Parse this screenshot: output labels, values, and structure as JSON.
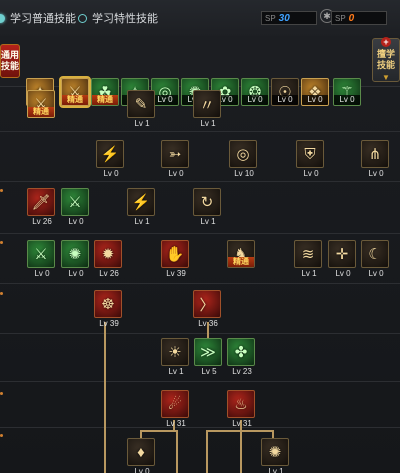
{
  "tabs": {
    "normal_label": "学习普通技能",
    "special_label": "学习特性技能"
  },
  "sp": {
    "blue_label": "SP",
    "blue_value": "30",
    "orange_label": "SP",
    "orange_value": "0"
  },
  "left_button": {
    "line1": "通用",
    "line2": "技能"
  },
  "right_button": {
    "line1": "擅学",
    "line2": "技能"
  },
  "quick_skills": [
    {
      "label": "精通",
      "style": "gold"
    },
    {
      "label": "精通",
      "style": "gold"
    },
    {
      "label": "精通",
      "style": "green"
    },
    {
      "label": "Lv 0",
      "style": "green"
    },
    {
      "label": "Lv 0",
      "style": "green"
    },
    {
      "label": "Lv 0",
      "style": "green"
    },
    {
      "label": "Lv 0",
      "style": "green"
    },
    {
      "label": "Lv 0",
      "style": "green"
    },
    {
      "label": "Lv 0",
      "style": "dark"
    },
    {
      "label": "Lv 0",
      "style": "gold"
    },
    {
      "label": "Lv 0",
      "style": "green"
    }
  ],
  "tree_skills": [
    {
      "label": "精通",
      "icon": "sword-slash-icon"
    },
    {
      "label": "Lv 1",
      "icon": "claw-icon"
    },
    {
      "label": "Lv 1",
      "icon": "wind-blade-icon"
    },
    {
      "label": "Lv 0",
      "icon": "dagger-icon"
    },
    {
      "label": "Lv 0",
      "icon": "arrow-icon"
    },
    {
      "label": "Lv 10",
      "icon": "spiral-icon"
    },
    {
      "label": "Lv 0",
      "icon": "shield-icon"
    },
    {
      "label": "Lv 0",
      "icon": "trident-icon"
    },
    {
      "label": "Lv 26",
      "icon": "blade-icon"
    },
    {
      "label": "Lv 0",
      "icon": "green-blade-icon"
    },
    {
      "label": "Lv 1",
      "icon": "strike-icon"
    },
    {
      "label": "Lv 1",
      "icon": "whirl-icon"
    },
    {
      "label": "Lv 0",
      "icon": "green-slash-icon"
    },
    {
      "label": "Lv 0",
      "icon": "green-burst-icon"
    },
    {
      "label": "Lv 26",
      "icon": "flame-orb-icon"
    },
    {
      "label": "Lv 39",
      "icon": "fire-hand-icon"
    },
    {
      "label": "精通",
      "icon": "warrior-icon"
    },
    {
      "label": "Lv 1",
      "icon": "wave-icon"
    },
    {
      "label": "Lv 0",
      "icon": "spark-icon"
    },
    {
      "label": "Lv 0",
      "icon": "crescent-icon"
    },
    {
      "label": "Lv 39",
      "icon": "fire-circle-icon"
    },
    {
      "label": "Lv 36",
      "icon": "fire-slash-icon"
    },
    {
      "label": "Lv 1",
      "icon": "sun-icon"
    },
    {
      "label": "Lv 5",
      "icon": "green-dash-icon"
    },
    {
      "label": "Lv 23",
      "icon": "green-figure-icon"
    },
    {
      "label": "Lv 31",
      "icon": "fire-fist-icon"
    },
    {
      "label": "Lv 31",
      "icon": "fire-figure-icon"
    },
    {
      "label": "Lv 0",
      "icon": "fire-pillar-icon"
    },
    {
      "label": "Lv 1",
      "icon": "vortex-icon"
    }
  ]
}
